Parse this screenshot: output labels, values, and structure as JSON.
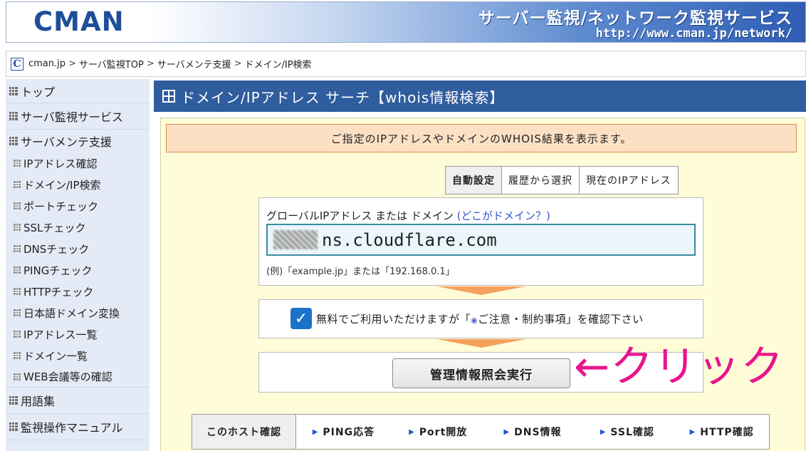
{
  "header": {
    "logo": "CMAN",
    "title": "サーバー監視/ネットワーク監視サービス",
    "url": "http://www.cman.jp/network/"
  },
  "breadcrumb": {
    "logo_letter": "C",
    "items": [
      "cman.jp",
      "サーバ監視TOP",
      "サーバメンテ支援",
      "ドメイン/IP検索"
    ],
    "separator": ">"
  },
  "sidebar": {
    "top_items": [
      "トップ",
      "サーバ監視サービス",
      "サーバメンテ支援"
    ],
    "sub_items": [
      "IPアドレス確認",
      "ドメイン/IP検索",
      "ポートチェック",
      "SSLチェック",
      "DNSチェック",
      "PINGチェック",
      "HTTPチェック",
      "日本語ドメイン変換",
      "IPアドレス一覧",
      "ドメイン一覧",
      "WEB会議等の確認"
    ],
    "bottom_items": [
      "用語集",
      "監視操作マニュアル"
    ]
  },
  "main": {
    "title": "ドメイン/IPアドレス サーチ【whois情報検索】",
    "notice": "ご指定のIPアドレスやドメインのWHOIS結果を表示ます。",
    "tabs": [
      "自動設定",
      "履歴から選択",
      "現在のIPアドレス"
    ],
    "input_label": "グローバルIPアドレス または ドメイン",
    "input_label_link": "(どこがドメイン？)",
    "input_value": "ns.cloudflare.com",
    "input_example": "(例)「example.jp」または「192.168.0.1」",
    "agree_prefix": "無料でご利用いただけますが「",
    "agree_link": "ご注意・制約事項",
    "agree_suffix": "」を確認下さい",
    "agree_checked": true,
    "execute_button": "管理情報照会実行",
    "annotation": "←クリック",
    "host_label": "このホスト確認",
    "host_links": [
      "PING応答",
      "Port開放",
      "DNS情報",
      "SSL確認",
      "HTTP確認"
    ]
  },
  "colors": {
    "title_bar": "#2f5d9e",
    "content_bg": "#fffcd8",
    "notice_bg": "#fce0c4",
    "notice_border": "#e08b4c",
    "sidebar_bg": "#e4ebf6",
    "annotation": "#e8158e",
    "checkbox": "#1a73c8"
  }
}
